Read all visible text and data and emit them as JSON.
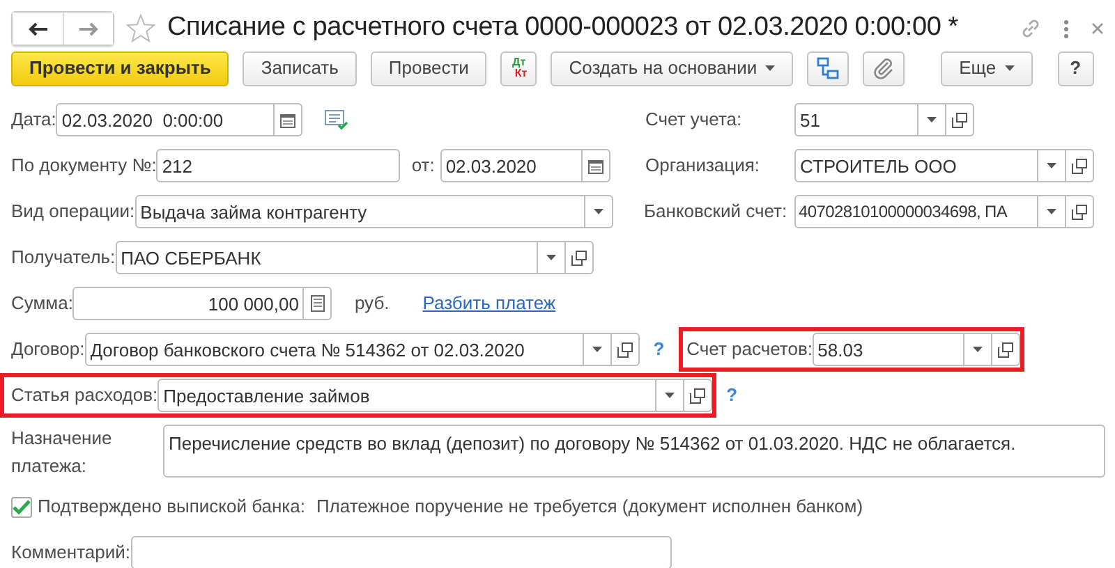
{
  "window": {
    "title": "Списание с расчетного счета 0000-000023 от 02.03.2020 0:00:00 *",
    "favorite": false
  },
  "toolbar": [
    {
      "kind": "primary",
      "label": "Провести и закрыть"
    },
    {
      "kind": "button",
      "label": "Записать"
    },
    {
      "kind": "button",
      "label": "Провести"
    },
    {
      "kind": "dtkt",
      "dt": "Дт",
      "kt": "Кт"
    },
    {
      "kind": "menu",
      "label": "Создать на основании"
    },
    {
      "kind": "structure"
    },
    {
      "kind": "attach"
    },
    {
      "kind": "menu",
      "label": "Еще"
    },
    {
      "kind": "help",
      "label": "?"
    }
  ],
  "form": {
    "date": {
      "label": "Дата:",
      "value": "02.03.2020  0:00:00"
    },
    "account": {
      "label": "Счет учета:",
      "value": "51"
    },
    "doc_number": {
      "label": "По документу №:",
      "value": "212"
    },
    "doc_date": {
      "label": "от:",
      "value": "02.03.2020"
    },
    "organization": {
      "label": "Организация:",
      "value": "СТРОИТЕЛЬ ООО"
    },
    "operation": {
      "label": "Вид операции:",
      "value": "Выдача займа контрагенту"
    },
    "bank_account": {
      "label": "Банковский счет:",
      "value": "40702810100000034698, ПА"
    },
    "recipient": {
      "label": "Получатель:",
      "value": "ПАО СБЕРБАНК"
    },
    "amount": {
      "label": "Сумма:",
      "value": "100 000,00",
      "currency": "руб.",
      "link": "Разбить платеж"
    },
    "contract": {
      "label": "Договор:",
      "value": "Договор банковского счета № 514362 от 02.03.2020",
      "help": "?"
    },
    "settlement_account": {
      "label": "Счет расчетов:",
      "value": "58.03",
      "highlighted": true
    },
    "expense_item": {
      "label": "Статья расходов:",
      "value": "Предоставление займов",
      "help": "?",
      "highlighted": true
    },
    "purpose": {
      "label": "Назначение платежа:",
      "value": "Перечисление средств во вклад (депозит) по договору № 514362 от 01.03.2020. НДС не облагается."
    },
    "confirmed": {
      "label": "Подтверждено выпиской банка:",
      "checked": true,
      "note": "Платежное поручение не требуется (документ исполнен банком)"
    },
    "comment": {
      "label": "Комментарий:"
    }
  }
}
